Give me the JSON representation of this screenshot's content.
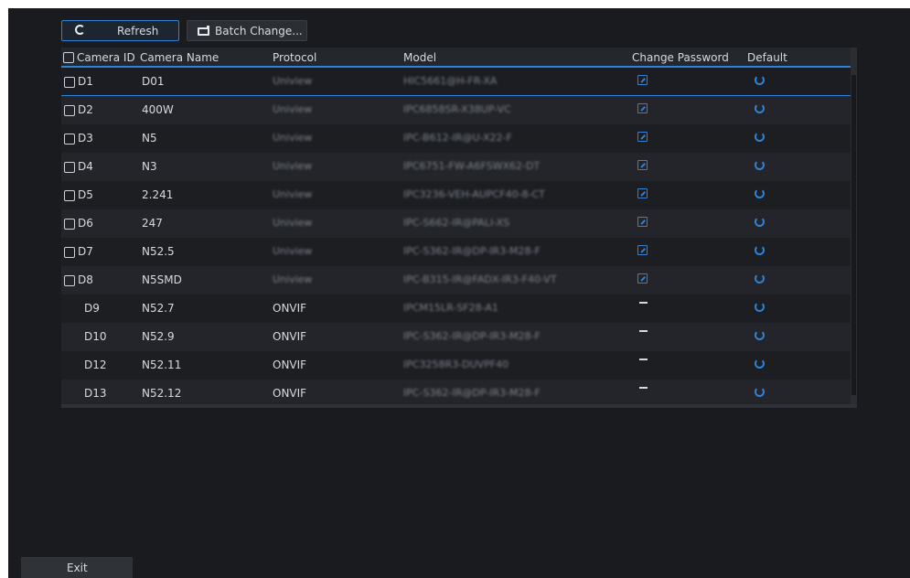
{
  "toolbar": {
    "refresh_label": "Refresh",
    "batch_label": "Batch Change..."
  },
  "table": {
    "columns": {
      "camera_id": "Camera ID",
      "camera_name": "Camera Name",
      "protocol": "Protocol",
      "model": "Model",
      "change_password": "Change Password",
      "default": "Default"
    },
    "rows": [
      {
        "id": "D1",
        "name": "D01",
        "protocol": "Uniview",
        "model": "HIC5661@H-FR-XA",
        "has_checkbox": true,
        "password_editable": true
      },
      {
        "id": "D2",
        "name": "400W",
        "protocol": "Uniview",
        "model": "IPC6858SR-X38UP-VC",
        "has_checkbox": true,
        "password_editable": true
      },
      {
        "id": "D3",
        "name": "N5",
        "protocol": "Uniview",
        "model": "IPC-B612-IR@U-X22-F",
        "has_checkbox": true,
        "password_editable": true
      },
      {
        "id": "D4",
        "name": "N3",
        "protocol": "Uniview",
        "model": "IPC6751-FW-A6FSWX62-DT",
        "has_checkbox": true,
        "password_editable": true
      },
      {
        "id": "D5",
        "name": "2.241",
        "protocol": "Uniview",
        "model": "IPC3236-VEH-AUPCF40-8-CT",
        "has_checkbox": true,
        "password_editable": true
      },
      {
        "id": "D6",
        "name": "247",
        "protocol": "Uniview",
        "model": "IPC-S662-IR@PALI-XS",
        "has_checkbox": true,
        "password_editable": true
      },
      {
        "id": "D7",
        "name": "N52.5",
        "protocol": "Uniview",
        "model": "IPC-S362-IR@DP-IR3-M28-F",
        "has_checkbox": true,
        "password_editable": true
      },
      {
        "id": "D8",
        "name": "N5SMD",
        "protocol": "Uniview",
        "model": "IPC-B315-IR@FADX-IR3-F40-VT",
        "has_checkbox": true,
        "password_editable": true
      },
      {
        "id": "D9",
        "name": "N52.7",
        "protocol": "ONVIF",
        "model": "IPCM15LR-SF28-A1",
        "has_checkbox": false,
        "password_editable": false
      },
      {
        "id": "D10",
        "name": "N52.9",
        "protocol": "ONVIF",
        "model": "IPC-S362-IR@DP-IR3-M28-F",
        "has_checkbox": false,
        "password_editable": false
      },
      {
        "id": "D12",
        "name": "N52.11",
        "protocol": "ONVIF",
        "model": "IPC3258R3-DUVPF40",
        "has_checkbox": false,
        "password_editable": false
      },
      {
        "id": "D13",
        "name": "N52.12",
        "protocol": "ONVIF",
        "model": "IPC-S362-IR@DP-IR3-M28-F",
        "has_checkbox": false,
        "password_editable": false
      }
    ]
  },
  "footer": {
    "exit_label": "Exit"
  },
  "colors": {
    "accent": "#2f83d6",
    "background": "#191b1f",
    "text": "#d7dade"
  },
  "icons": {
    "refresh": "refresh-icon",
    "batch": "edit-batch-icon",
    "password": "edit-icon",
    "default": "restore-icon"
  }
}
